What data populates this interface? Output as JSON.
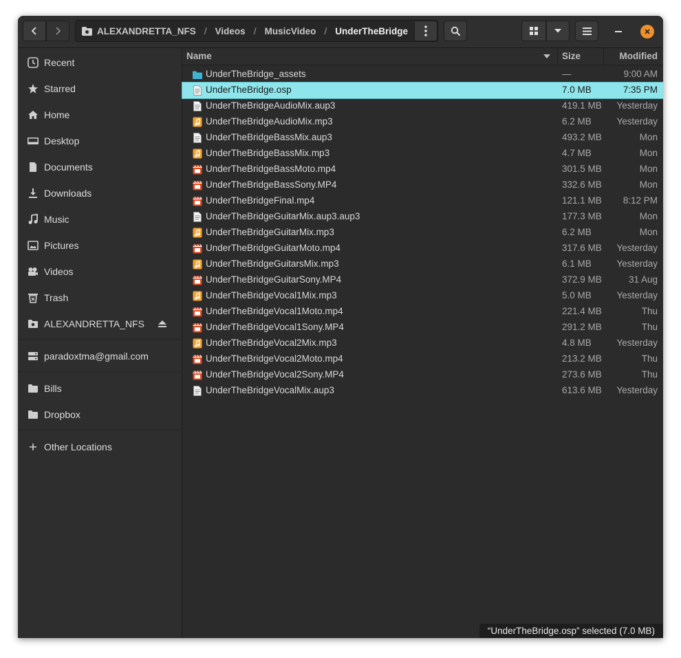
{
  "pathbar": {
    "crumbs": [
      "ALEXANDRETTA_NFS",
      "Videos",
      "MusicVideo",
      "UnderTheBridge"
    ],
    "separator": "/"
  },
  "sidebar": {
    "items": [
      {
        "label": "Recent",
        "icon": "clock-icon"
      },
      {
        "label": "Starred",
        "icon": "star-icon"
      },
      {
        "label": "Home",
        "icon": "home-icon"
      },
      {
        "label": "Desktop",
        "icon": "desktop-icon"
      },
      {
        "label": "Documents",
        "icon": "document-icon"
      },
      {
        "label": "Downloads",
        "icon": "download-icon"
      },
      {
        "label": "Music",
        "icon": "music-icon"
      },
      {
        "label": "Pictures",
        "icon": "picture-icon"
      },
      {
        "label": "Videos",
        "icon": "video-icon"
      },
      {
        "label": "Trash",
        "icon": "trash-icon"
      },
      {
        "label": "ALEXANDRETTA_NFS",
        "icon": "network-folder-icon"
      },
      {
        "label": "paradoxtma@gmail.com",
        "icon": "server-icon"
      },
      {
        "label": "Bills",
        "icon": "folder-icon"
      },
      {
        "label": "Dropbox",
        "icon": "folder-icon"
      },
      {
        "label": "Other Locations",
        "icon": "plus-icon"
      }
    ]
  },
  "columns": {
    "name": "Name",
    "size": "Size",
    "modified": "Modified"
  },
  "files": [
    {
      "name": "UnderTheBridge_assets",
      "size": "—",
      "modified": "9:00 AM",
      "type": "folder"
    },
    {
      "name": "UnderTheBridge.osp",
      "size": "7.0 MB",
      "modified": "7:35 PM",
      "type": "text"
    },
    {
      "name": "UnderTheBridgeAudioMix.aup3",
      "size": "419.1 MB",
      "modified": "Yesterday",
      "type": "text"
    },
    {
      "name": "UnderTheBridgeAudioMix.mp3",
      "size": "6.2 MB",
      "modified": "Yesterday",
      "type": "audio"
    },
    {
      "name": "UnderTheBridgeBassMix.aup3",
      "size": "493.2 MB",
      "modified": "Mon",
      "type": "text"
    },
    {
      "name": "UnderTheBridgeBassMix.mp3",
      "size": "4.7 MB",
      "modified": "Mon",
      "type": "audio"
    },
    {
      "name": "UnderTheBridgeBassMoto.mp4",
      "size": "301.5 MB",
      "modified": "Mon",
      "type": "video"
    },
    {
      "name": "UnderTheBridgeBassSony.MP4",
      "size": "332.6 MB",
      "modified": "Mon",
      "type": "video"
    },
    {
      "name": "UnderTheBridgeFinal.mp4",
      "size": "121.1 MB",
      "modified": "8:12 PM",
      "type": "video"
    },
    {
      "name": "UnderTheBridgeGuitarMix.aup3.aup3",
      "size": "177.3 MB",
      "modified": "Mon",
      "type": "text"
    },
    {
      "name": "UnderTheBridgeGuitarMix.mp3",
      "size": "6.2 MB",
      "modified": "Mon",
      "type": "audio"
    },
    {
      "name": "UnderTheBridgeGuitarMoto.mp4",
      "size": "317.6 MB",
      "modified": "Yesterday",
      "type": "video"
    },
    {
      "name": "UnderTheBridgeGuitarsMix.mp3",
      "size": "6.1 MB",
      "modified": "Yesterday",
      "type": "audio"
    },
    {
      "name": "UnderTheBridgeGuitarSony.MP4",
      "size": "372.9 MB",
      "modified": "31 Aug",
      "type": "video"
    },
    {
      "name": "UnderTheBridgeVocal1Mix.mp3",
      "size": "5.0 MB",
      "modified": "Yesterday",
      "type": "audio"
    },
    {
      "name": "UnderTheBridgeVocal1Moto.mp4",
      "size": "221.4 MB",
      "modified": "Thu",
      "type": "video"
    },
    {
      "name": "UnderTheBridgeVocal1Sony.MP4",
      "size": "291.2 MB",
      "modified": "Thu",
      "type": "video"
    },
    {
      "name": "UnderTheBridgeVocal2Mix.mp3",
      "size": "4.8 MB",
      "modified": "Yesterday",
      "type": "audio"
    },
    {
      "name": "UnderTheBridgeVocal2Moto.mp4",
      "size": "213.2 MB",
      "modified": "Thu",
      "type": "video"
    },
    {
      "name": "UnderTheBridgeVocal2Sony.MP4",
      "size": "273.6 MB",
      "modified": "Thu",
      "type": "video"
    },
    {
      "name": "UnderTheBridgeVocalMix.aup3",
      "size": "613.6 MB",
      "modified": "Yesterday",
      "type": "text"
    }
  ],
  "selected_index": 1,
  "status": "“UnderTheBridge.osp” selected  (7.0 MB)",
  "colors": {
    "accent": "#8ee6ec",
    "close": "#f0902a",
    "folder": "#3fb3d4",
    "audio": "#f2a431",
    "video": "#e04a1f"
  }
}
